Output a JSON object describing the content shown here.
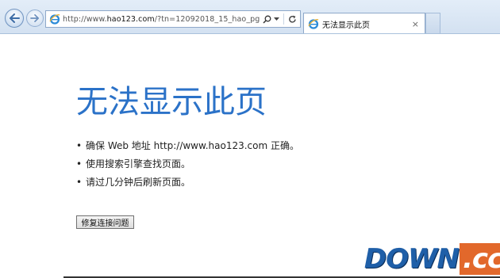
{
  "browser": {
    "url_prefix": "http://www.",
    "url_domain": "hao123.com",
    "url_rest": "/?tn=12092018_15_hao_pg",
    "tab_title": "无法显示此页",
    "tab_close": "×",
    "icons": {
      "back": "back-arrow-icon",
      "forward": "forward-arrow-icon",
      "site": "ie-icon",
      "search": "search-icon",
      "dropdown": "chevron-down-icon",
      "refresh": "refresh-icon"
    },
    "accent": "#2b72c8"
  },
  "page": {
    "title": "无法显示此页",
    "bullets": [
      "确保 Web 地址 http://www.hao123.com 正确。",
      "使用搜索引擎查找页面。",
      "请过几分钟后刷新页面。"
    ],
    "bullet_glyph": "•",
    "fix_button": "修复连接问题"
  },
  "watermark": {
    "left": "DOWN",
    "right": ".cc",
    "colors": {
      "left": "#1f5fa8",
      "right_bg": "#e2682b"
    }
  }
}
